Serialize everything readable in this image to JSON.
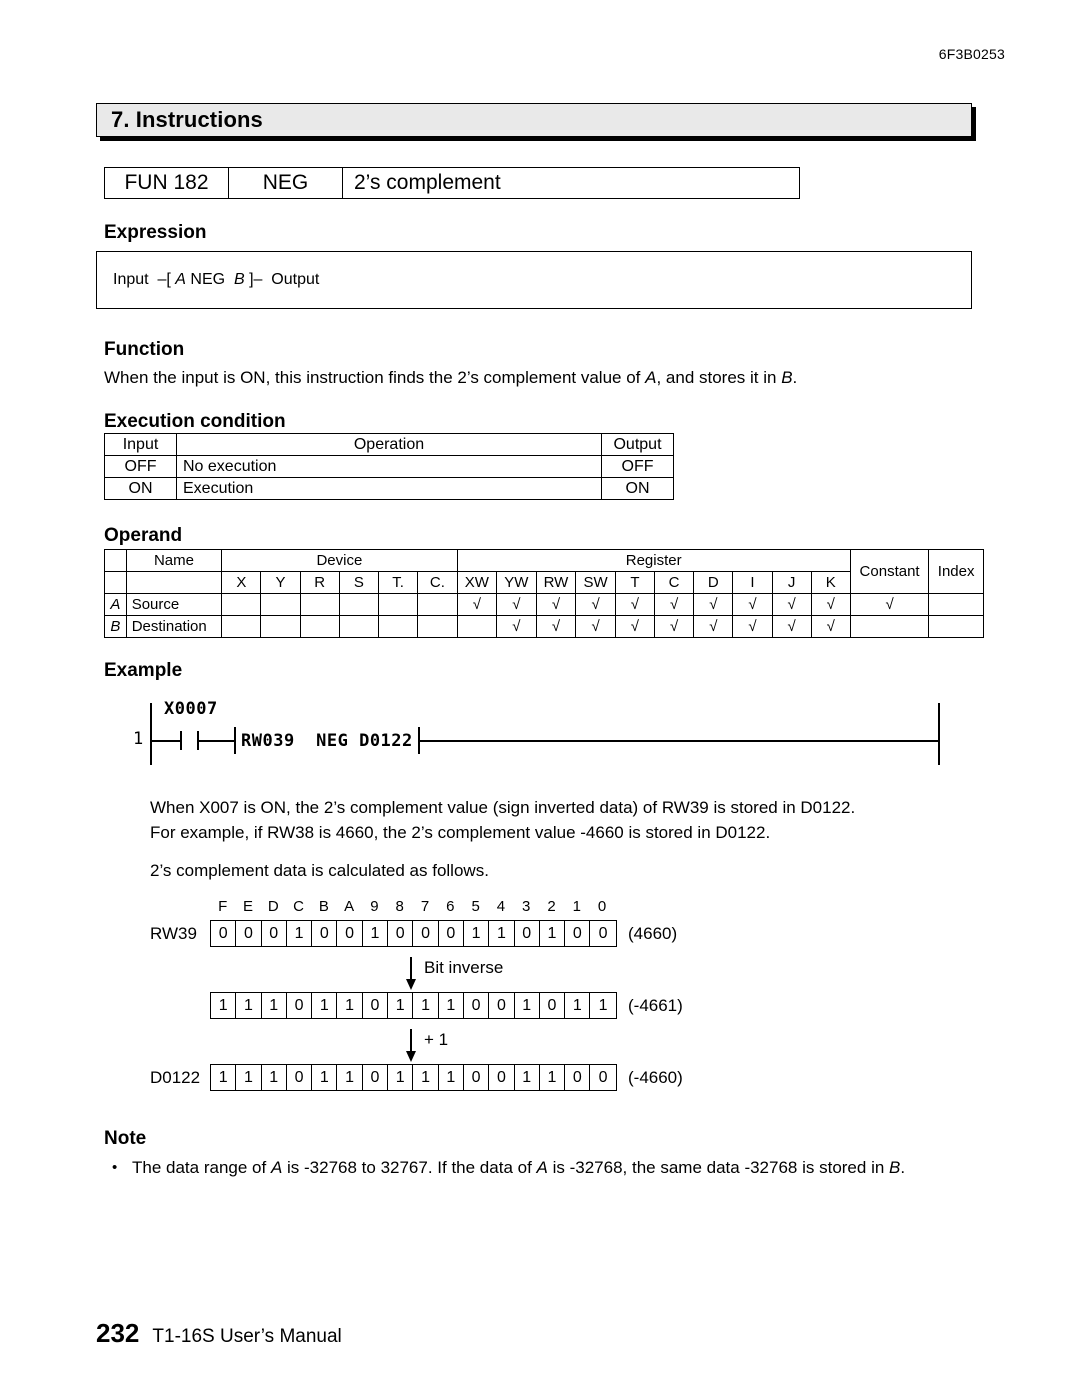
{
  "header": {
    "doc_code": "6F3B0253",
    "chapter": "7. Instructions"
  },
  "fun_bar": {
    "number": "FUN 182",
    "mnemonic": "NEG",
    "description": "2’s complement"
  },
  "sections": {
    "expression": "Expression",
    "function": "Function",
    "execution_condition": "Execution condition",
    "operand": "Operand",
    "example": "Example",
    "note": "Note"
  },
  "expression": {
    "prefix": "Input  –[ ",
    "operand_a": "A",
    "mnemonic": " NEG  ",
    "operand_b": "B",
    "suffix": " ]–  Output"
  },
  "function": {
    "text_1": "When the input is ON, this instruction finds the 2’s complement value of ",
    "a": "A",
    "text_2": ", and stores it in ",
    "b": "B",
    "text_3": "."
  },
  "execution_table": {
    "headers": [
      "Input",
      "Operation",
      "Output"
    ],
    "rows": [
      [
        "OFF",
        "No execution",
        "OFF"
      ],
      [
        "ON",
        "Execution",
        "ON"
      ]
    ]
  },
  "operand_table": {
    "group_headers": [
      "Name",
      "Device",
      "Register",
      "Constant",
      "Index"
    ],
    "device_columns": [
      "X",
      "Y",
      "R",
      "S",
      "T.",
      "C."
    ],
    "register_columns": [
      "XW",
      "YW",
      "RW",
      "SW",
      "T",
      "C",
      "D",
      "I",
      "J",
      "K"
    ],
    "check": "√",
    "rows": [
      {
        "symbol": "A",
        "name": "Source",
        "device": [
          "",
          "",
          "",
          "",
          "",
          ""
        ],
        "register": [
          "√",
          "√",
          "√",
          "√",
          "√",
          "√",
          "√",
          "√",
          "√",
          "√"
        ],
        "constant": "√",
        "index": ""
      },
      {
        "symbol": "B",
        "name": "Destination",
        "device": [
          "",
          "",
          "",
          "",
          "",
          ""
        ],
        "register": [
          "",
          "√",
          "√",
          "√",
          "√",
          "√",
          "√",
          "√",
          "√",
          "√"
        ],
        "constant": "",
        "index": ""
      }
    ]
  },
  "ladder": {
    "rung_number": "1",
    "contact_label": "X0007",
    "instruction": "RW039  NEG D0122"
  },
  "example_text": {
    "paragraph_1_line_1": "When X007 is ON, the 2’s complement value (sign inverted data) of RW39 is stored in D0122.",
    "paragraph_1_line_2": "For example, if RW38 is 4660, the 2’s complement value -4660 is stored in D0122.",
    "paragraph_2": "2’s complement data is calculated as follows."
  },
  "bit_diagram": {
    "bit_labels": [
      "F",
      "E",
      "D",
      "C",
      "B",
      "A",
      "9",
      "8",
      "7",
      "6",
      "5",
      "4",
      "3",
      "2",
      "1",
      "0"
    ],
    "rows": [
      {
        "name": "RW39",
        "bits": [
          "0",
          "0",
          "0",
          "1",
          "0",
          "0",
          "1",
          "0",
          "0",
          "0",
          "1",
          "1",
          "0",
          "1",
          "0",
          "0"
        ],
        "value": "(4660)"
      },
      {
        "name": "",
        "bits": [
          "1",
          "1",
          "1",
          "0",
          "1",
          "1",
          "0",
          "1",
          "1",
          "1",
          "0",
          "0",
          "1",
          "0",
          "1",
          "1"
        ],
        "value": "(-4661)"
      },
      {
        "name": "D0122",
        "bits": [
          "1",
          "1",
          "1",
          "0",
          "1",
          "1",
          "0",
          "1",
          "1",
          "1",
          "0",
          "0",
          "1",
          "1",
          "0",
          "0"
        ],
        "value": "(-4660)"
      }
    ],
    "arrow_1": "Bit inverse",
    "arrow_2": "+ 1"
  },
  "note": {
    "bullet": "•",
    "text_1": "The data range of ",
    "a1": "A",
    "text_2": " is -32768 to 32767. If the data of ",
    "a2": "A",
    "text_3": " is -32768, the same data -32768 is stored in ",
    "b": "B",
    "text_4": "."
  },
  "footer": {
    "page_number": "232",
    "manual_title": "T1-16S User’s Manual"
  }
}
